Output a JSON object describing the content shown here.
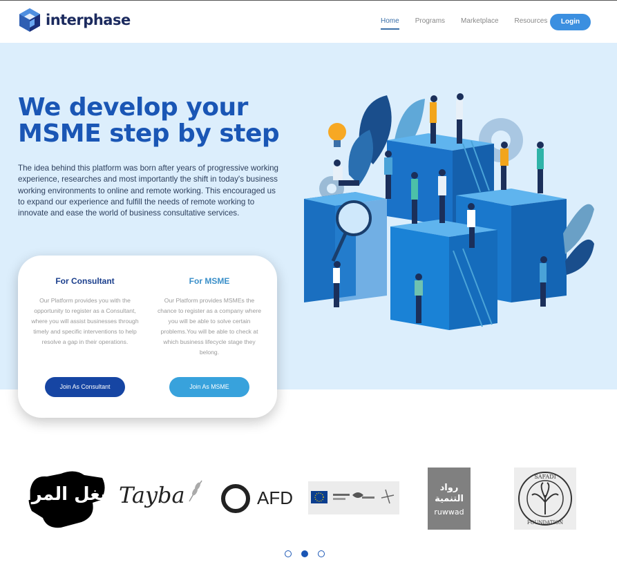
{
  "header": {
    "brand": "interphase",
    "nav": [
      "Home",
      "Programs",
      "Marketplace",
      "Resources"
    ],
    "active_nav": "Home",
    "login_label": "Login"
  },
  "hero": {
    "title_line1": "We develop your",
    "title_line2": "MSME step by step",
    "description": "The idea behind this platform was born after years of progressive working experience, researches and most importantly the shift in today's business working environments to online and remote working. This encouraged us to expand our experience and fulfill the needs of remote working to innovate and ease the world of business consultative services."
  },
  "cards": {
    "consultant": {
      "title": "For Consultant",
      "text": "Our Platform provides you with the opportunity to register as a Consultant, where you will assist businesses through timely and specific interventions to help resolve a gap in their operations.",
      "button": "Join As Consultant"
    },
    "msme": {
      "title": "For MSME",
      "text": "Our Platform provides MSMEs the chance to register as a company where you will be able to solve certain problems.You will be able to check at which business lifecycle stage they belong.",
      "button": "Join As MSME"
    }
  },
  "partners": {
    "afd": "AFD",
    "tayba": "Tayba",
    "ruwwad_ar": "رواد التنمية",
    "ruwwad_en": "ruwwad",
    "safadi": "SAFADI",
    "foundation": "FOUNDATION",
    "shoghl": "شغل المرأة"
  },
  "carousel": {
    "count": 3,
    "active_index": 1
  },
  "colors": {
    "primary": "#1a56b5",
    "hero_bg": "#dceefc",
    "login": "#3b8fe0",
    "dark_button": "#1645a3",
    "light_button": "#38a2dc"
  }
}
